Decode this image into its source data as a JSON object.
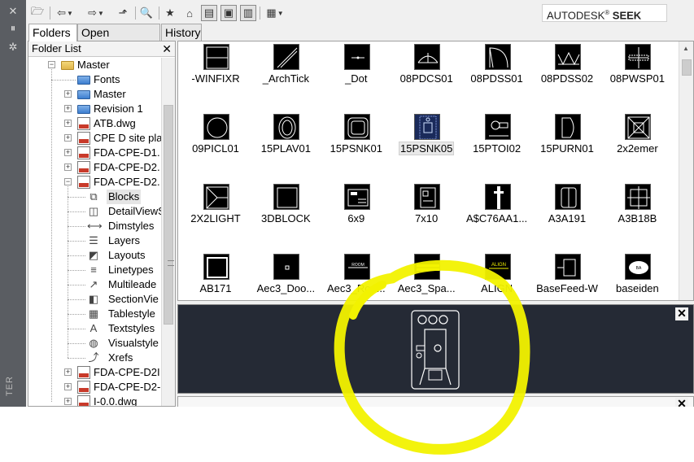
{
  "side_strip": {
    "buttons": [
      {
        "icon": "close-icon",
        "glyph": "✕"
      },
      {
        "icon": "auto-hide-icon",
        "glyph": "⏸"
      },
      {
        "icon": "properties-icon",
        "glyph": "✲"
      }
    ],
    "vertical_title": "TER"
  },
  "toolbar": {
    "brand_prefix": "AUTODESK",
    "brand_reg": "®",
    "brand_suffix": " SEEK",
    "buttons": [
      {
        "name": "load-button",
        "icon": "open-folder-icon",
        "glyph": "🗁"
      },
      {
        "name": "back-button",
        "icon": "back-arrow-icon",
        "glyph": "⇦"
      },
      {
        "name": "forward-button",
        "icon": "forward-arrow-icon",
        "glyph": "⇨"
      },
      {
        "name": "up-button",
        "icon": "up-folder-icon",
        "glyph": "⬏"
      },
      {
        "name": "search-button",
        "icon": "search-icon",
        "glyph": "🔍"
      },
      {
        "name": "favorites-button",
        "icon": "favorites-icon",
        "glyph": "★"
      },
      {
        "name": "home-button",
        "icon": "home-icon",
        "glyph": "⌂"
      },
      {
        "name": "tree-view-toggle",
        "icon": "tree-view-icon",
        "glyph": "▤"
      },
      {
        "name": "preview-toggle",
        "icon": "preview-icon",
        "glyph": "▣"
      },
      {
        "name": "description-toggle",
        "icon": "description-icon",
        "glyph": "▥"
      },
      {
        "name": "views-button",
        "icon": "views-icon",
        "glyph": "▦"
      }
    ]
  },
  "tabs": [
    {
      "label": "Folders",
      "active": true
    },
    {
      "label": "Open Drawings",
      "active": false
    },
    {
      "label": "History",
      "active": false
    }
  ],
  "folder_list": {
    "title": "Folder List",
    "close_glyph": "✕",
    "items": [
      {
        "label": "Master",
        "icon": "open-folder-icon",
        "type": "folder-open",
        "expander": "−"
      },
      {
        "label": "Fonts",
        "icon": "folder-icon",
        "type": "folder",
        "expander": ""
      },
      {
        "label": "Master",
        "icon": "folder-icon",
        "type": "folder",
        "expander": "+"
      },
      {
        "label": "Revision 1",
        "icon": "folder-icon",
        "type": "folder",
        "expander": "+"
      },
      {
        "label": "ATB.dwg",
        "icon": "dwg-file-icon",
        "type": "dwg",
        "expander": "+"
      },
      {
        "label": "CPE D site pla",
        "icon": "dwg-file-icon",
        "type": "dwg",
        "expander": "+"
      },
      {
        "label": "FDA-CPE-D1.",
        "icon": "dwg-file-icon",
        "type": "dwg",
        "expander": "+"
      },
      {
        "label": "FDA-CPE-D2.",
        "icon": "dwg-file-icon",
        "type": "dwg",
        "expander": "+"
      },
      {
        "label": "FDA-CPE-D2.",
        "icon": "dwg-file-icon",
        "type": "dwg",
        "expander": "−"
      },
      {
        "label": "Blocks",
        "icon": "blocks-icon",
        "type": "child",
        "glyph": "⧉",
        "selected": true
      },
      {
        "label": "DetailViewS",
        "icon": "detail-view-icon",
        "type": "child",
        "glyph": "◫"
      },
      {
        "label": "Dimstyles",
        "icon": "dimstyles-icon",
        "type": "child",
        "glyph": "⟷"
      },
      {
        "label": "Layers",
        "icon": "layers-icon",
        "type": "child",
        "glyph": "☰"
      },
      {
        "label": "Layouts",
        "icon": "layouts-icon",
        "type": "child",
        "glyph": "◩"
      },
      {
        "label": "Linetypes",
        "icon": "linetypes-icon",
        "type": "child",
        "glyph": "≡"
      },
      {
        "label": "Multileade",
        "icon": "multileader-icon",
        "type": "child",
        "glyph": "↗"
      },
      {
        "label": "SectionVie",
        "icon": "section-view-icon",
        "type": "child",
        "glyph": "◧"
      },
      {
        "label": "Tablestyle",
        "icon": "tablestyle-icon",
        "type": "child",
        "glyph": "▦"
      },
      {
        "label": "Textstyles",
        "icon": "textstyles-icon",
        "type": "child",
        "glyph": "A"
      },
      {
        "label": "Visualstyle",
        "icon": "visualstyle-icon",
        "type": "child",
        "glyph": "◍"
      },
      {
        "label": "Xrefs",
        "icon": "xrefs-icon",
        "type": "child",
        "glyph": "⤴"
      },
      {
        "label": "FDA-CPE-D2I",
        "icon": "dwg-file-icon",
        "type": "dwg",
        "expander": "+"
      },
      {
        "label": "FDA-CPE-D2-",
        "icon": "dwg-file-icon",
        "type": "dwg",
        "expander": "+"
      },
      {
        "label": "I-0.0.dwg",
        "icon": "dwg-file-icon",
        "type": "dwg",
        "expander": "+"
      }
    ]
  },
  "blocks": [
    {
      "name": "-WINFIXR",
      "art": "winfixr"
    },
    {
      "name": "_ArchTick",
      "art": "archtick"
    },
    {
      "name": "_Dot",
      "art": "dot"
    },
    {
      "name": "08PDCS01",
      "art": "pdcs"
    },
    {
      "name": "08PDSS01",
      "art": "pdss"
    },
    {
      "name": "08PDSS02",
      "art": "pdss02"
    },
    {
      "name": "08PWSP01",
      "art": "pwsp"
    },
    {
      "name": "09PICL01",
      "art": "circle"
    },
    {
      "name": "15PLAV01",
      "art": "plav"
    },
    {
      "name": "15PSNK01",
      "art": "psnk"
    },
    {
      "name": "15PSNK05",
      "art": "psnk05",
      "selected": true
    },
    {
      "name": "15PTOI02",
      "art": "ptoi"
    },
    {
      "name": "15PURN01",
      "art": "purn"
    },
    {
      "name": "2x2emer",
      "art": "emer"
    },
    {
      "name": "2X2LIGHT",
      "art": "light"
    },
    {
      "name": "3DBLOCK",
      "art": "block3d"
    },
    {
      "name": "6x9",
      "art": "six9"
    },
    {
      "name": "7x10",
      "art": "seven10"
    },
    {
      "name": "A$C76AA1...",
      "art": "ac76"
    },
    {
      "name": "A3A191",
      "art": "a3a191"
    },
    {
      "name": "A3B18B",
      "art": "a3b18b"
    },
    {
      "name": "AB171",
      "art": "ab171"
    },
    {
      "name": "Aec3_Doo...",
      "art": "aecdoor"
    },
    {
      "name": "Aec3_Roo...",
      "art": "aecroom"
    },
    {
      "name": "Aec3_Spa...",
      "art": "aecspace"
    },
    {
      "name": "ALIGN",
      "art": "align"
    },
    {
      "name": "BaseFeed-W",
      "art": "basefeed"
    },
    {
      "name": "baseiden",
      "art": "baseiden"
    }
  ],
  "pane_close_glyph": "✕",
  "colors": {
    "annotation": "#f2f200",
    "preview_bg": "#252a35",
    "side_strip": "#5a5d62"
  }
}
